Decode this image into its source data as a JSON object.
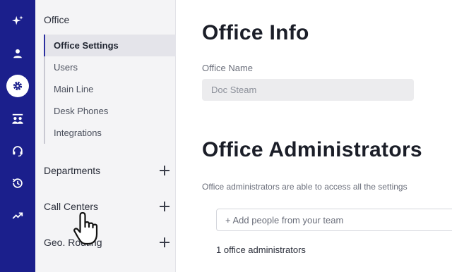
{
  "rail": {
    "items": [
      {
        "name": "sparkle",
        "active": false
      },
      {
        "name": "person",
        "active": false
      },
      {
        "name": "gear",
        "active": true
      },
      {
        "name": "team",
        "active": false
      },
      {
        "name": "headset",
        "active": false
      },
      {
        "name": "history",
        "active": false
      },
      {
        "name": "trending",
        "active": false
      }
    ],
    "accent": "#1b1f8c"
  },
  "sidebar": {
    "heading": "Office",
    "sub_items": [
      {
        "label": "Office Settings",
        "active": true
      },
      {
        "label": "Users",
        "active": false
      },
      {
        "label": "Main Line",
        "active": false
      },
      {
        "label": "Desk Phones",
        "active": false
      },
      {
        "label": "Integrations",
        "active": false
      }
    ],
    "sections": [
      {
        "label": "Departments"
      },
      {
        "label": "Call Centers"
      },
      {
        "label": "Geo. Routing"
      }
    ]
  },
  "main": {
    "office_info_title": "Office Info",
    "office_name_label": "Office Name",
    "office_name_value": "Doc Steam",
    "admins_title": "Office Administrators",
    "admins_description": "Office administrators are able to access all the settings",
    "add_people_placeholder": "+ Add people from your team",
    "admins_count": "1 office administrators"
  }
}
